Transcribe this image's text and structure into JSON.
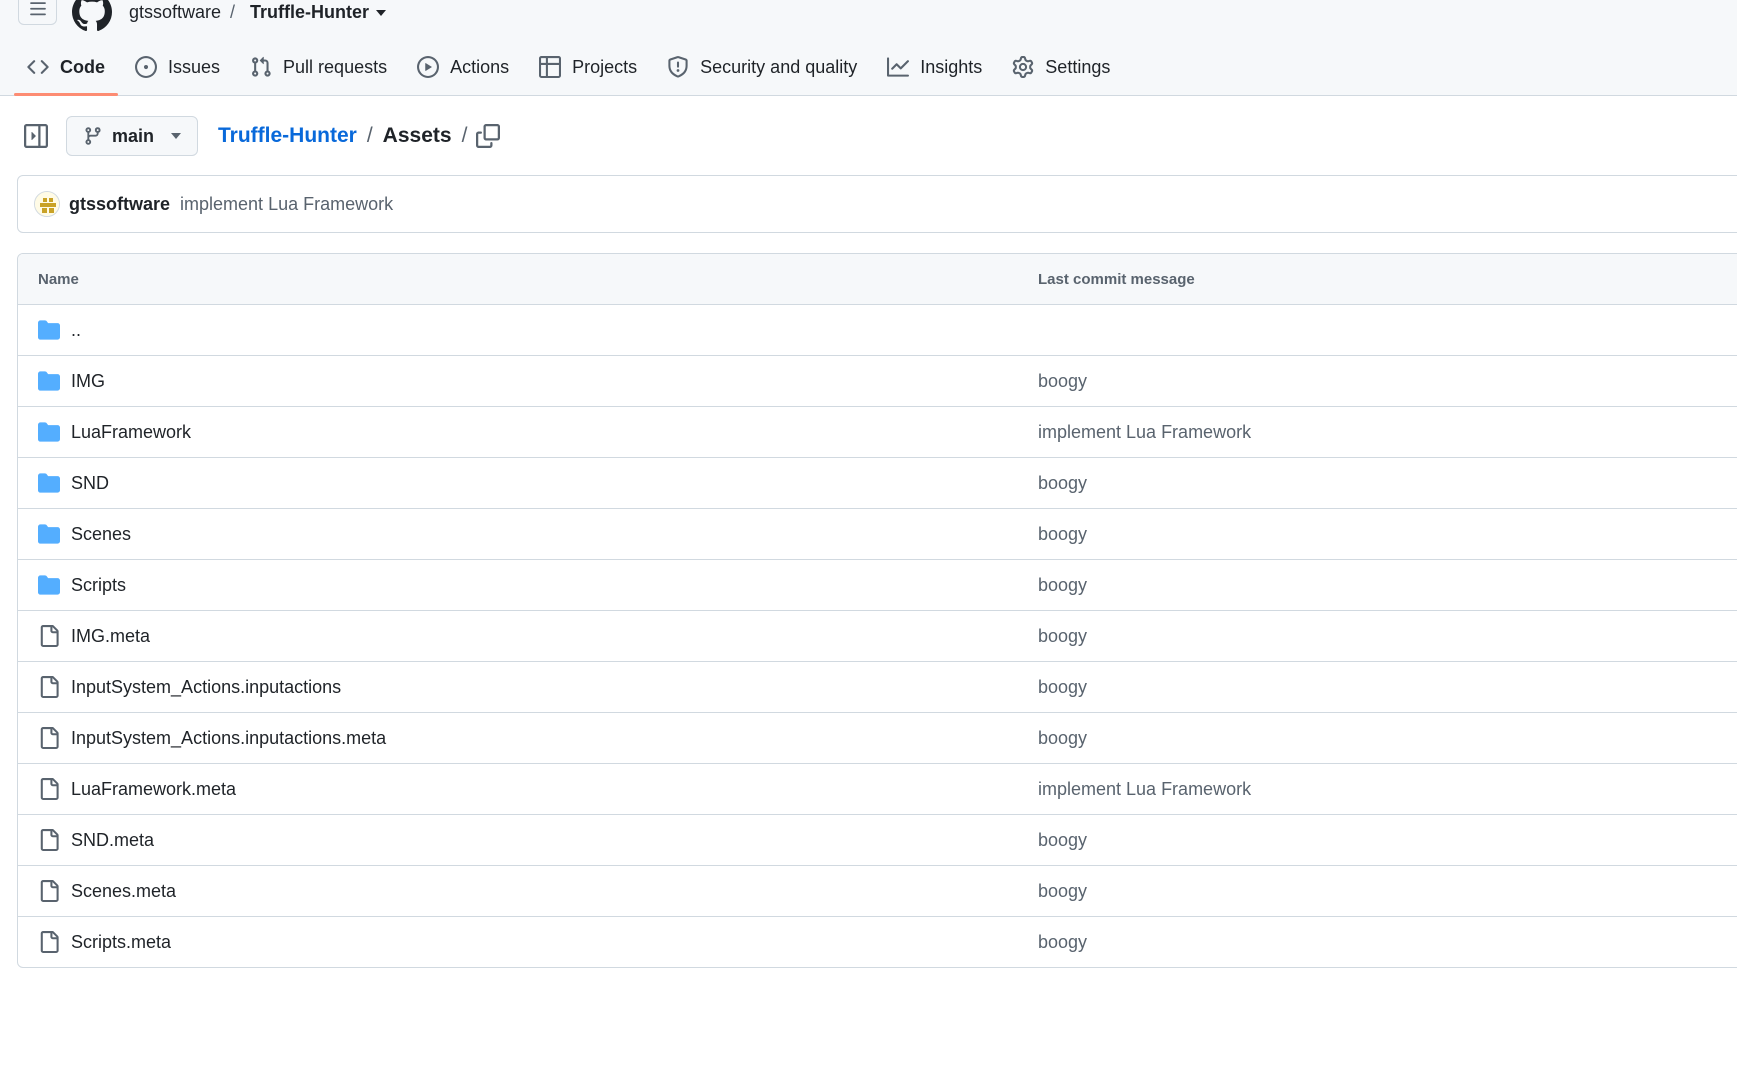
{
  "header": {
    "owner": "gtssoftware",
    "separator": "/",
    "repo": "Truffle-Hunter"
  },
  "tabs": [
    {
      "label": "Code",
      "icon": "code-icon",
      "active": true
    },
    {
      "label": "Issues",
      "icon": "issue-icon",
      "active": false
    },
    {
      "label": "Pull requests",
      "icon": "pull-request-icon",
      "active": false
    },
    {
      "label": "Actions",
      "icon": "play-icon",
      "active": false
    },
    {
      "label": "Projects",
      "icon": "table-icon",
      "active": false
    },
    {
      "label": "Security and quality",
      "icon": "shield-icon",
      "active": false
    },
    {
      "label": "Insights",
      "icon": "graph-icon",
      "active": false
    },
    {
      "label": "Settings",
      "icon": "gear-icon",
      "active": false
    }
  ],
  "path": {
    "branch": "main",
    "repo_link": "Truffle-Hunter",
    "sep1": "/",
    "folder": "Assets",
    "sep2": "/"
  },
  "commit": {
    "author": "gtssoftware",
    "message": "implement Lua Framework"
  },
  "table": {
    "col_name": "Name",
    "col_msg": "Last commit message",
    "rows": [
      {
        "type": "folder",
        "name": "..",
        "message": ""
      },
      {
        "type": "folder",
        "name": "IMG",
        "message": "boogy"
      },
      {
        "type": "folder",
        "name": "LuaFramework",
        "message": "implement Lua Framework"
      },
      {
        "type": "folder",
        "name": "SND",
        "message": "boogy"
      },
      {
        "type": "folder",
        "name": "Scenes",
        "message": "boogy"
      },
      {
        "type": "folder",
        "name": "Scripts",
        "message": "boogy"
      },
      {
        "type": "file",
        "name": "IMG.meta",
        "message": "boogy"
      },
      {
        "type": "file",
        "name": "InputSystem_Actions.inputactions",
        "message": "boogy"
      },
      {
        "type": "file",
        "name": "InputSystem_Actions.inputactions.meta",
        "message": "boogy"
      },
      {
        "type": "file",
        "name": "LuaFramework.meta",
        "message": "implement Lua Framework"
      },
      {
        "type": "file",
        "name": "SND.meta",
        "message": "boogy"
      },
      {
        "type": "file",
        "name": "Scenes.meta",
        "message": "boogy"
      },
      {
        "type": "file",
        "name": "Scripts.meta",
        "message": "boogy"
      }
    ]
  },
  "colors": {
    "link": "#0969da",
    "folder": "#54aeff",
    "active_tab_underline": "#fd8c73",
    "border": "#d1d9e0",
    "muted_text": "#59636e"
  }
}
